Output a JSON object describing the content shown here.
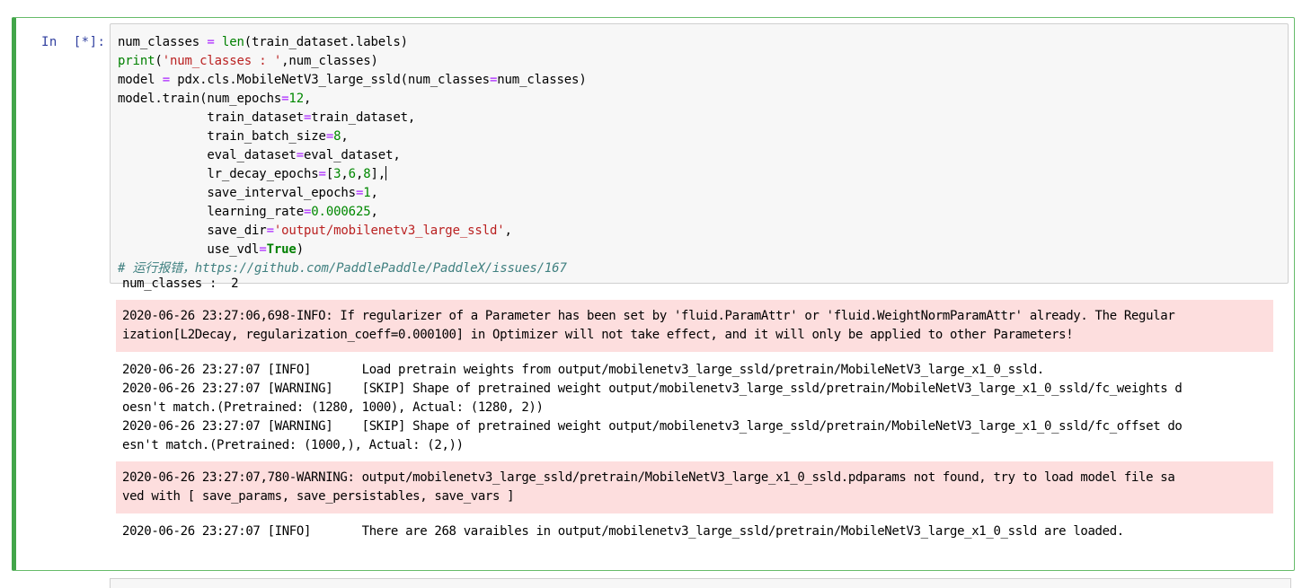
{
  "cell": {
    "prompt": "In  [*]:",
    "code": {
      "l1_a": "num_classes ",
      "l1_op": "=",
      "l1_b": " ",
      "l1_len": "len",
      "l1_c": "(train_dataset.labels)",
      "l2_print": "print",
      "l2_a": "(",
      "l2_str": "'num_classes : '",
      "l2_b": ",num_classes)",
      "l3_a": "model ",
      "l3_op": "=",
      "l3_b": " pdx.cls.MobileNetV3_large_ssld(num_classes",
      "l3_op2": "=",
      "l3_c": "num_classes)",
      "l4_a": "model.train(num_epochs",
      "l4_op": "=",
      "l4_num": "12",
      "l4_b": ",",
      "l5_a": "train_dataset",
      "l5_op": "=",
      "l5_b": "train_dataset,",
      "l6_a": "train_batch_size",
      "l6_op": "=",
      "l6_num": "8",
      "l6_b": ",",
      "l7_a": "eval_dataset",
      "l7_op": "=",
      "l7_b": "eval_dataset,",
      "l8_a": "lr_decay_epochs",
      "l8_op": "=",
      "l8_b": "[",
      "l8_n1": "3",
      "l8_c1": ",",
      "l8_n2": "6",
      "l8_c2": ",",
      "l8_n3": "8",
      "l8_c3": "],",
      "l9_a": "save_interval_epochs",
      "l9_op": "=",
      "l9_num": "1",
      "l9_b": ",",
      "l10_a": "learning_rate",
      "l10_op": "=",
      "l10_num": "0.000625",
      "l10_b": ",",
      "l11_a": "save_dir",
      "l11_op": "=",
      "l11_str": "'output/mobilenetv3_large_ssld'",
      "l11_b": ",",
      "l12_a": "use_vdl",
      "l12_op": "=",
      "l12_kw": "True",
      "l12_b": ")",
      "l13_comment": "# 运行报错，https://github.com/PaddlePaddle/PaddleX/issues/167"
    },
    "outputs": {
      "o1": "num_classes :  2",
      "o2": "2020-06-26 23:27:06,698-INFO: If regularizer of a Parameter has been set by 'fluid.ParamAttr' or 'fluid.WeightNormParamAttr' already. The Regular\nization[L2Decay, regularization_coeff=0.000100] in Optimizer will not take effect, and it will only be applied to other Parameters!",
      "o3": "2020-06-26 23:27:07 [INFO]\tLoad pretrain weights from output/mobilenetv3_large_ssld/pretrain/MobileNetV3_large_x1_0_ssld.\n2020-06-26 23:27:07 [WARNING]\t[SKIP] Shape of pretrained weight output/mobilenetv3_large_ssld/pretrain/MobileNetV3_large_x1_0_ssld/fc_weights d\noesn't match.(Pretrained: (1280, 1000), Actual: (1280, 2))\n2020-06-26 23:27:07 [WARNING]\t[SKIP] Shape of pretrained weight output/mobilenetv3_large_ssld/pretrain/MobileNetV3_large_x1_0_ssld/fc_offset do\nesn't match.(Pretrained: (1000,), Actual: (2,))",
      "o4": "2020-06-26 23:27:07,780-WARNING: output/mobilenetv3_large_ssld/pretrain/MobileNetV3_large_x1_0_ssld.pdparams not found, try to load model file sa\nved with [ save_params, save_persistables, save_vars ]",
      "o5": "2020-06-26 23:27:07 [INFO]\tThere are 268 varaibles in output/mobilenetv3_large_ssld/pretrain/MobileNetV3_large_x1_0_ssld are loaded."
    }
  }
}
